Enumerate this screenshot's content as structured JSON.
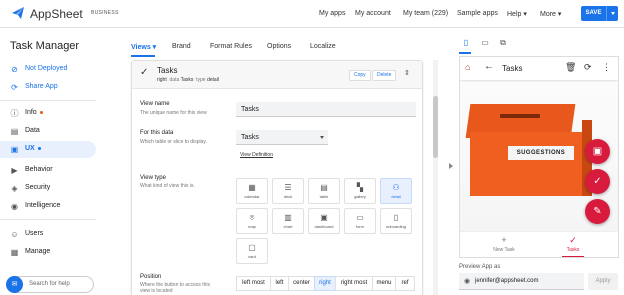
{
  "header": {
    "app_name": "AppSheet",
    "tier": "BUSINESS",
    "nav": [
      "My apps",
      "My account",
      "My team (229)",
      "Sample apps",
      "Help ▾",
      "More ▾"
    ],
    "save_label": "SAVE"
  },
  "sidebar": {
    "app_title": "Task Manager",
    "status": "Not Deployed",
    "share": "Share App",
    "items": [
      {
        "label": "Info",
        "icon": "info-icon"
      },
      {
        "label": "Data",
        "icon": "data-icon"
      },
      {
        "label": "UX",
        "icon": "ux-icon"
      },
      {
        "label": "Behavior",
        "icon": "behavior-icon"
      },
      {
        "label": "Security",
        "icon": "security-icon"
      },
      {
        "label": "Intelligence",
        "icon": "intelligence-icon"
      },
      {
        "label": "Users",
        "icon": "users-icon"
      },
      {
        "label": "Manage",
        "icon": "manage-icon"
      }
    ],
    "search_placeholder": "Search for help"
  },
  "tabs": [
    "Views",
    "Brand",
    "Format Rules",
    "Options",
    "Localize"
  ],
  "view_card": {
    "title": "Tasks",
    "meta_view": "right",
    "meta_data_label": "data",
    "meta_data": "Tasks",
    "meta_type_label": "type",
    "meta_type": "detail",
    "copy_label": "Copy",
    "delete_label": "Delete",
    "view_name_label": "View name",
    "view_name_sub": "The unique name for this view",
    "view_name_value": "Tasks",
    "for_data_label": "For this data",
    "for_data_sub": "Which table or slice to display.",
    "for_data_value": "Tasks",
    "view_definition_link": "View Definition",
    "view_type_label": "View type",
    "view_type_sub": "What kind of view this is.",
    "view_types": [
      {
        "label": "calendar",
        "glyph": "▦"
      },
      {
        "label": "deck",
        "glyph": "☰"
      },
      {
        "label": "table",
        "glyph": "▤"
      },
      {
        "label": "gallery",
        "glyph": "▚"
      },
      {
        "label": "detail",
        "glyph": "⚇"
      },
      {
        "label": "map",
        "glyph": "⌾"
      },
      {
        "label": "chart",
        "glyph": "▥"
      },
      {
        "label": "dashboard",
        "glyph": "▣"
      },
      {
        "label": "form",
        "glyph": "▭"
      },
      {
        "label": "onboarding",
        "glyph": "▯"
      },
      {
        "label": "card",
        "glyph": "▢"
      }
    ],
    "selected_view_type": "detail",
    "position_label": "Position",
    "position_sub1": "Where the button to access this",
    "position_sub2": "view is located",
    "positions": [
      "left most",
      "left",
      "center",
      "right",
      "right most",
      "menu",
      "ref"
    ],
    "selected_position": "right"
  },
  "preview": {
    "header_title": "Tasks",
    "image_text": "SUGGESTIONS",
    "bottom_tabs": [
      "New Task",
      "Tasks"
    ],
    "preview_as_label": "Preview App as",
    "preview_as_value": "jennifer@appsheet.com",
    "apply_label": "Apply"
  },
  "colors": {
    "accent": "#1a73e8",
    "app_primary": "#d81b3c",
    "box_orange": "#ef5f20"
  }
}
